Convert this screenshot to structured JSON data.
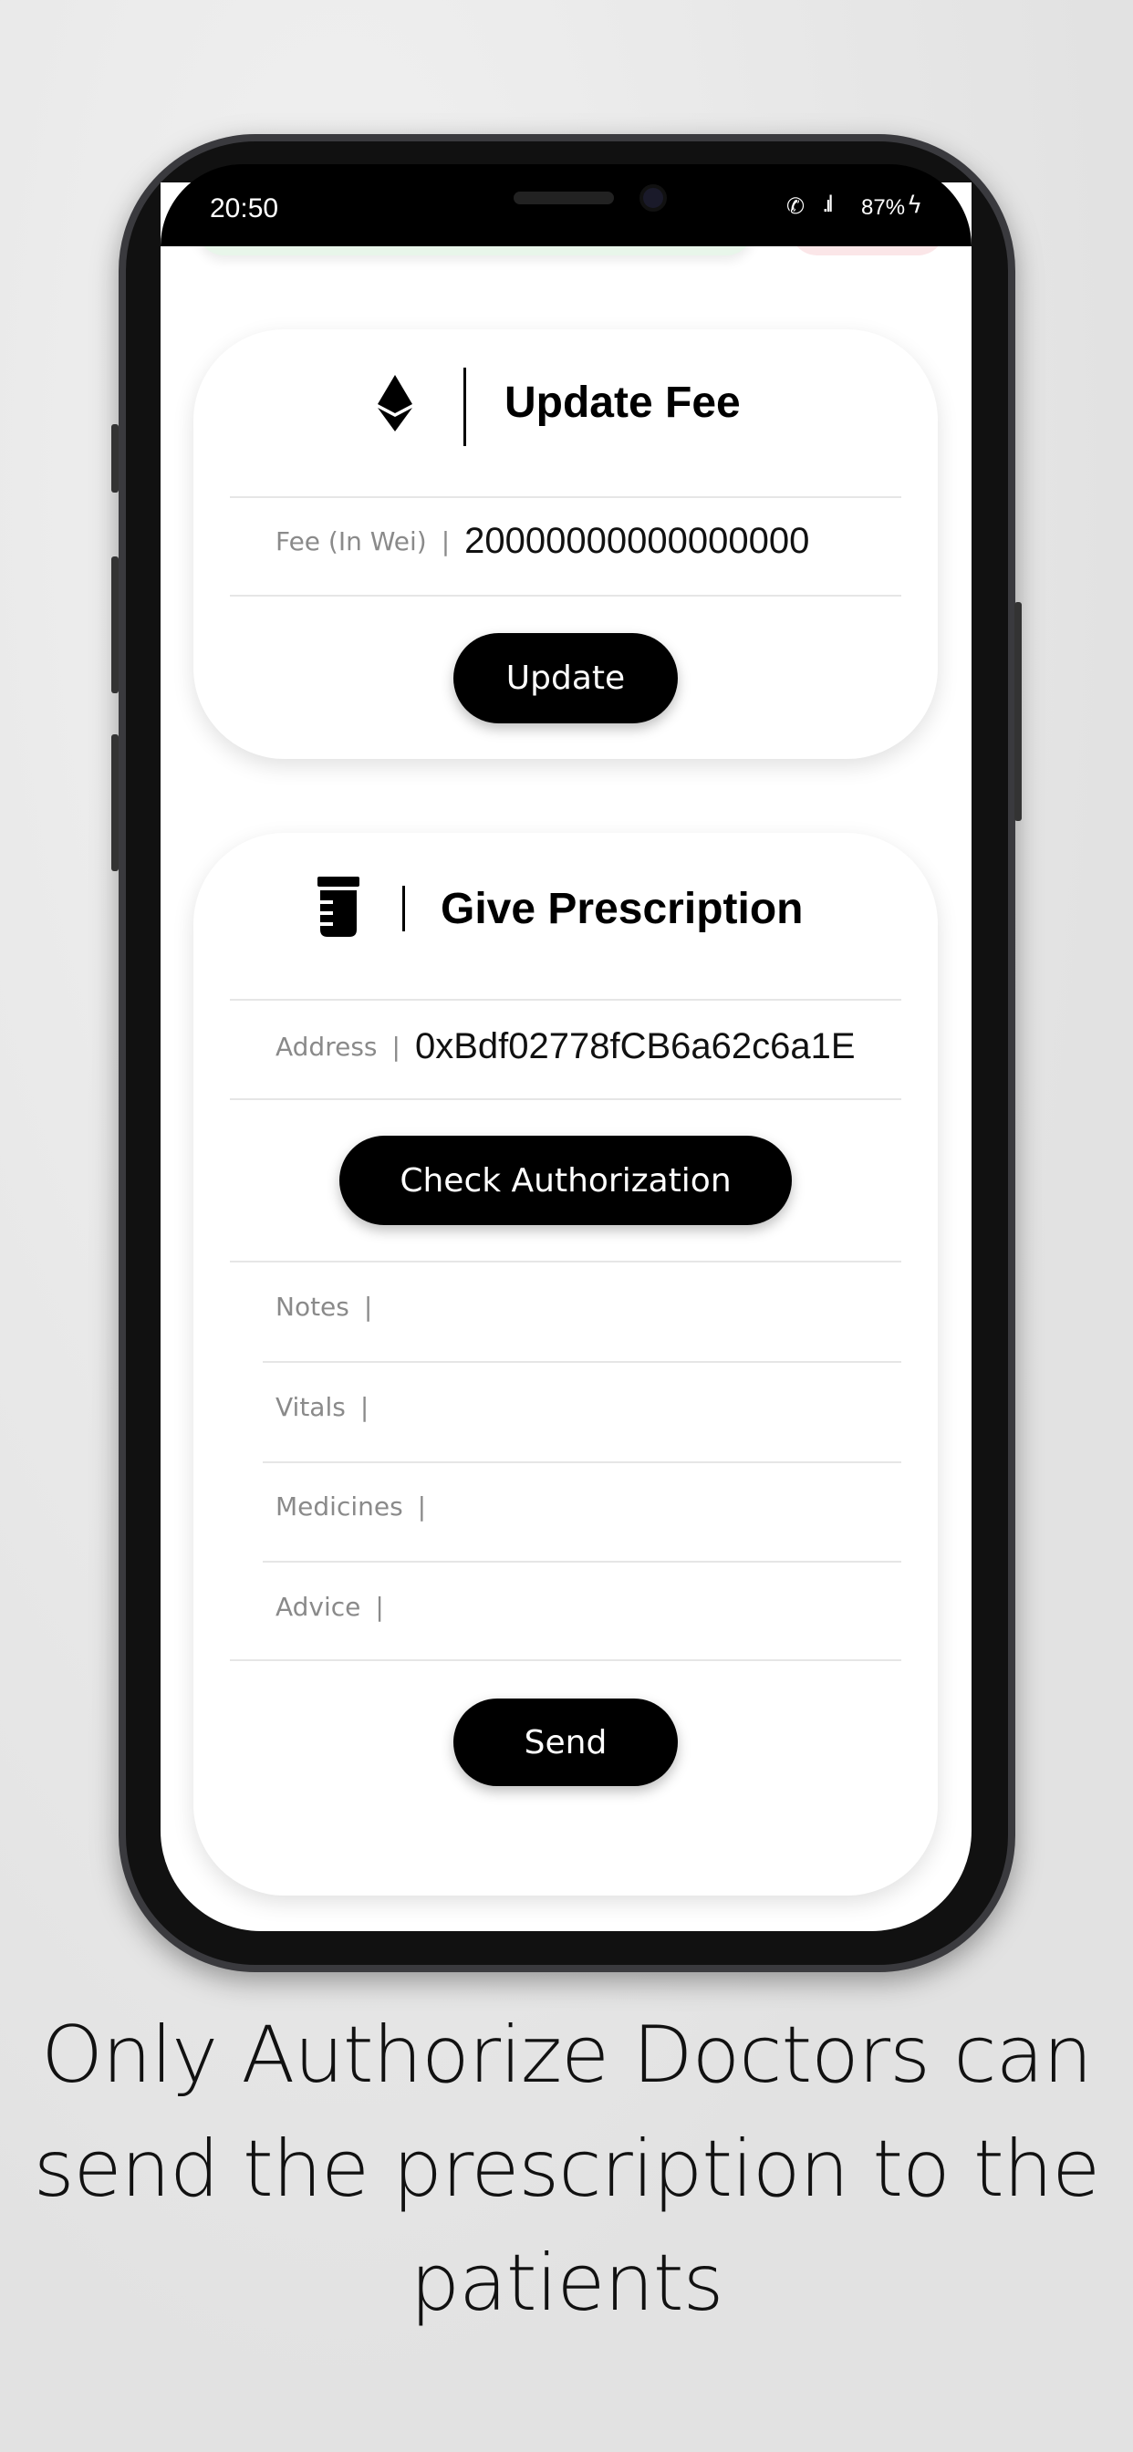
{
  "status_bar": {
    "time": "20:50",
    "battery": "87%",
    "icons": [
      "wifi-call-icon",
      "signal-icon",
      "charging-icon"
    ]
  },
  "update_fee": {
    "icon": "ethereum-icon",
    "title": "Update Fee",
    "fee_label": "Fee (In Wei)",
    "fee_value": "20000000000000000",
    "button": "Update"
  },
  "prescription": {
    "icon": "medicine-jar-icon",
    "title": "Give Prescription",
    "address_label": "Address",
    "address_value": "0xBdf02778fCB6a62c6a1E",
    "check_button": "Check Authorization",
    "fields": [
      {
        "label": "Notes",
        "value": ""
      },
      {
        "label": "Vitals",
        "value": ""
      },
      {
        "label": "Medicines",
        "value": ""
      },
      {
        "label": "Advice",
        "value": ""
      }
    ],
    "send_button": "Send"
  },
  "caption": {
    "line1": "Only Authorize Doctors can",
    "line2": "send the prescription to the",
    "line3": "patients"
  }
}
